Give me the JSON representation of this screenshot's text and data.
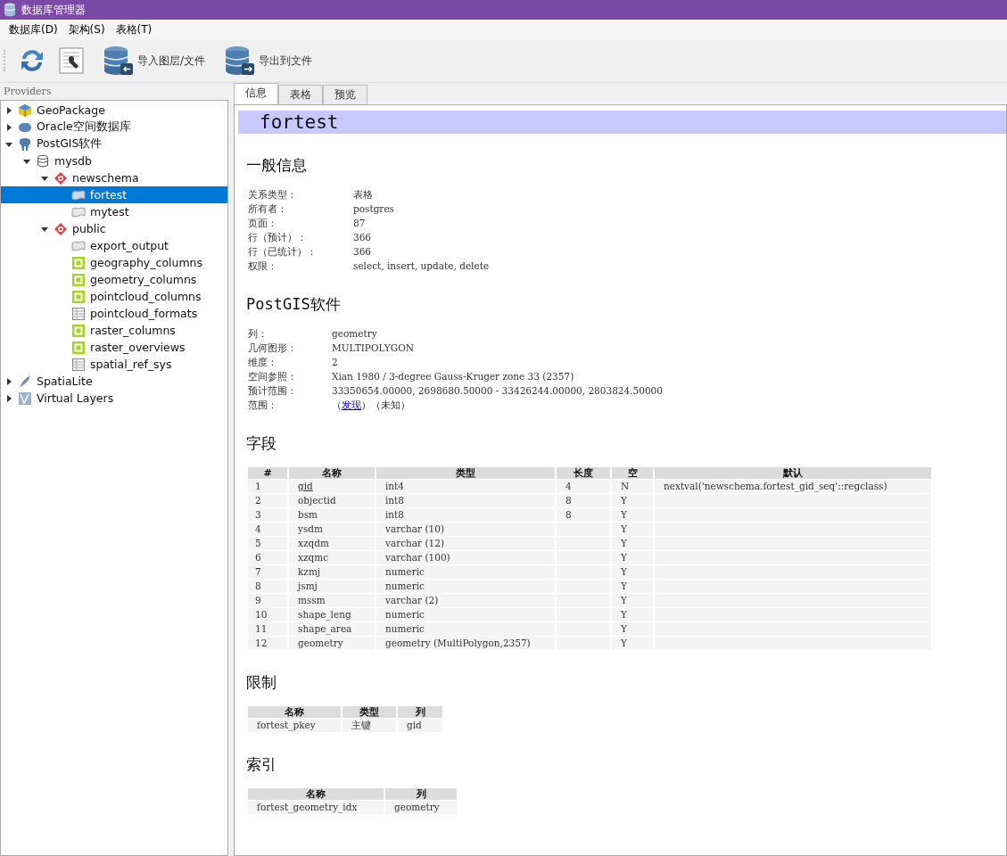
{
  "window": {
    "title": "数据库管理器"
  },
  "menu": [
    "数据库(D)",
    "架构(S)",
    "表格(T)"
  ],
  "toolbar": [
    {
      "kind": "refresh"
    },
    {
      "kind": "sql"
    },
    {
      "kind": "import",
      "label": "导入图层/文件"
    },
    {
      "kind": "export",
      "label": "导出到文件"
    }
  ],
  "sidebar": {
    "title": "Providers",
    "items": [
      {
        "label": "GeoPackage",
        "kind": "geopackage",
        "expanded": false,
        "selected": false
      },
      {
        "label": "Oracle空间数据库",
        "kind": "oracle",
        "expanded": false,
        "selected": false
      },
      {
        "label": "PostGIS软件",
        "kind": "postgis",
        "expanded": true,
        "selected": false,
        "children": [
          {
            "label": "mysdb",
            "kind": "database",
            "expanded": true,
            "selected": false,
            "children": [
              {
                "label": "newschema",
                "kind": "schema",
                "expanded": true,
                "selected": false,
                "children": [
                  {
                    "label": "fortest",
                    "kind": "layer",
                    "selected": true
                  },
                  {
                    "label": "mytest",
                    "kind": "layer",
                    "selected": false
                  }
                ]
              },
              {
                "label": "public",
                "kind": "schema",
                "expanded": true,
                "selected": false,
                "children": [
                  {
                    "label": "export_output",
                    "kind": "layer",
                    "selected": false
                  },
                  {
                    "label": "geography_columns",
                    "kind": "view",
                    "selected": false
                  },
                  {
                    "label": "geometry_columns",
                    "kind": "view",
                    "selected": false
                  },
                  {
                    "label": "pointcloud_columns",
                    "kind": "view",
                    "selected": false
                  },
                  {
                    "label": "pointcloud_formats",
                    "kind": "table",
                    "selected": false
                  },
                  {
                    "label": "raster_columns",
                    "kind": "view",
                    "selected": false
                  },
                  {
                    "label": "raster_overviews",
                    "kind": "view",
                    "selected": false
                  },
                  {
                    "label": "spatial_ref_sys",
                    "kind": "table",
                    "selected": false
                  }
                ]
              }
            ]
          }
        ]
      },
      {
        "label": "SpatiaLite",
        "kind": "spatialite",
        "expanded": false,
        "selected": false
      },
      {
        "label": "Virtual Layers",
        "kind": "virtual",
        "expanded": false,
        "selected": false
      }
    ]
  },
  "tabs": [
    {
      "label": "信息",
      "selected": true
    },
    {
      "label": "表格",
      "selected": false
    },
    {
      "label": "预览",
      "selected": false
    }
  ],
  "info": {
    "title": "fortest",
    "general": {
      "heading": "一般信息",
      "rows": [
        {
          "label": "关系类型：",
          "value": "表格"
        },
        {
          "label": "所有者：",
          "value": "postgres"
        },
        {
          "label": "页面：",
          "value": "87"
        },
        {
          "label": "行（预计）：",
          "value": "366"
        },
        {
          "label": "行（已统计）：",
          "value": "366"
        },
        {
          "label": "权限：",
          "value": "select, insert, update, delete"
        }
      ]
    },
    "postgis": {
      "heading": "PostGIS软件",
      "rows": [
        {
          "label": "列：",
          "value": "geometry"
        },
        {
          "label": "几何图形：",
          "value": "MULTIPOLYGON"
        },
        {
          "label": "维度：",
          "value": "2"
        },
        {
          "label": "空间参照：",
          "value": "Xian 1980 / 3-degree Gauss-Kruger zone 33 (2357)"
        },
        {
          "label": "预计范围：",
          "value": "33350654.00000, 2698680.50000 - 33426244.00000, 2803824.50000"
        },
        {
          "label": "范围：",
          "prefix": "（",
          "link": "发现",
          "suffix": "）（未知）"
        }
      ]
    },
    "fields": {
      "heading": "字段",
      "columns": [
        "#",
        "名称",
        "类型",
        "长度",
        "空",
        "默认"
      ],
      "rows": [
        {
          "num": "1",
          "name": "gid",
          "primary_key": true,
          "type": "int4",
          "length": "4",
          "null": "N",
          "default": "nextval('newschema.fortest_gid_seq'::regclass)"
        },
        {
          "num": "2",
          "name": "objectid",
          "primary_key": false,
          "type": "int8",
          "length": "8",
          "null": "Y"
        },
        {
          "num": "3",
          "name": "bsm",
          "primary_key": false,
          "type": "int8",
          "length": "8",
          "null": "Y"
        },
        {
          "num": "4",
          "name": "ysdm",
          "primary_key": false,
          "type": "varchar (10)",
          "null": "Y"
        },
        {
          "num": "5",
          "name": "xzqdm",
          "primary_key": false,
          "type": "varchar (12)",
          "null": "Y"
        },
        {
          "num": "6",
          "name": "xzqmc",
          "primary_key": false,
          "type": "varchar (100)",
          "null": "Y"
        },
        {
          "num": "7",
          "name": "kzmj",
          "primary_key": false,
          "type": "numeric",
          "null": "Y"
        },
        {
          "num": "8",
          "name": "jsmj",
          "primary_key": false,
          "type": "numeric",
          "null": "Y"
        },
        {
          "num": "9",
          "name": "mssm",
          "primary_key": false,
          "type": "varchar (2)",
          "null": "Y"
        },
        {
          "num": "10",
          "name": "shape_leng",
          "primary_key": false,
          "type": "numeric",
          "null": "Y"
        },
        {
          "num": "11",
          "name": "shape_area",
          "primary_key": false,
          "type": "numeric",
          "null": "Y"
        },
        {
          "num": "12",
          "name": "geometry",
          "primary_key": false,
          "type": "geometry (MultiPolygon,2357)",
          "null": "Y"
        }
      ]
    },
    "constraints": {
      "heading": "限制",
      "columns": [
        "名称",
        "类型",
        "列"
      ],
      "rows": [
        [
          "fortest_pkey",
          "主键",
          "gid"
        ]
      ]
    },
    "indexes": {
      "heading": "索引",
      "columns": [
        "名称",
        "列"
      ],
      "rows": [
        [
          "fortest_geometry_idx",
          "geometry"
        ]
      ]
    }
  }
}
